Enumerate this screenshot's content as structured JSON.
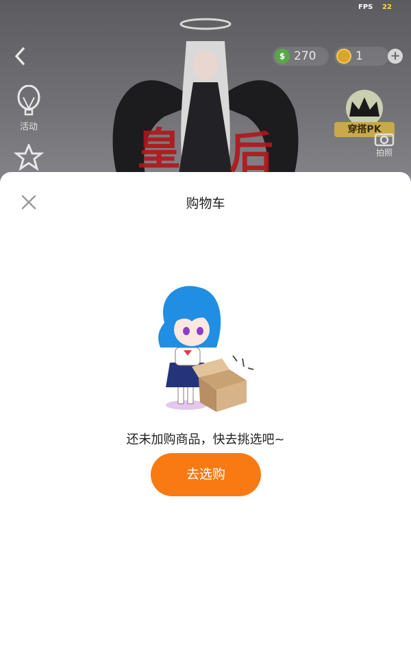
{
  "status": {
    "fps_label": "FPS",
    "fps_value": "22"
  },
  "header": {
    "currencies": [
      {
        "icon": "s-coin-icon",
        "amount": "270",
        "color": "#5aa74a"
      },
      {
        "icon": "gold-coin-icon",
        "amount": "1",
        "color": "#d9a52a"
      }
    ]
  },
  "side_menu": {
    "items": [
      {
        "label": "活动",
        "icon": "hot-air-balloon-icon"
      }
    ]
  },
  "pk": {
    "label": "穿搭PK",
    "icon": "crown-icon"
  },
  "photo": {
    "label": "拍照",
    "icon": "camera-icon"
  },
  "cart": {
    "title": "购物车",
    "empty_message": "还未加购商品，快去挑选吧~",
    "shop_button": "去选购",
    "accent": "#f97a12"
  }
}
